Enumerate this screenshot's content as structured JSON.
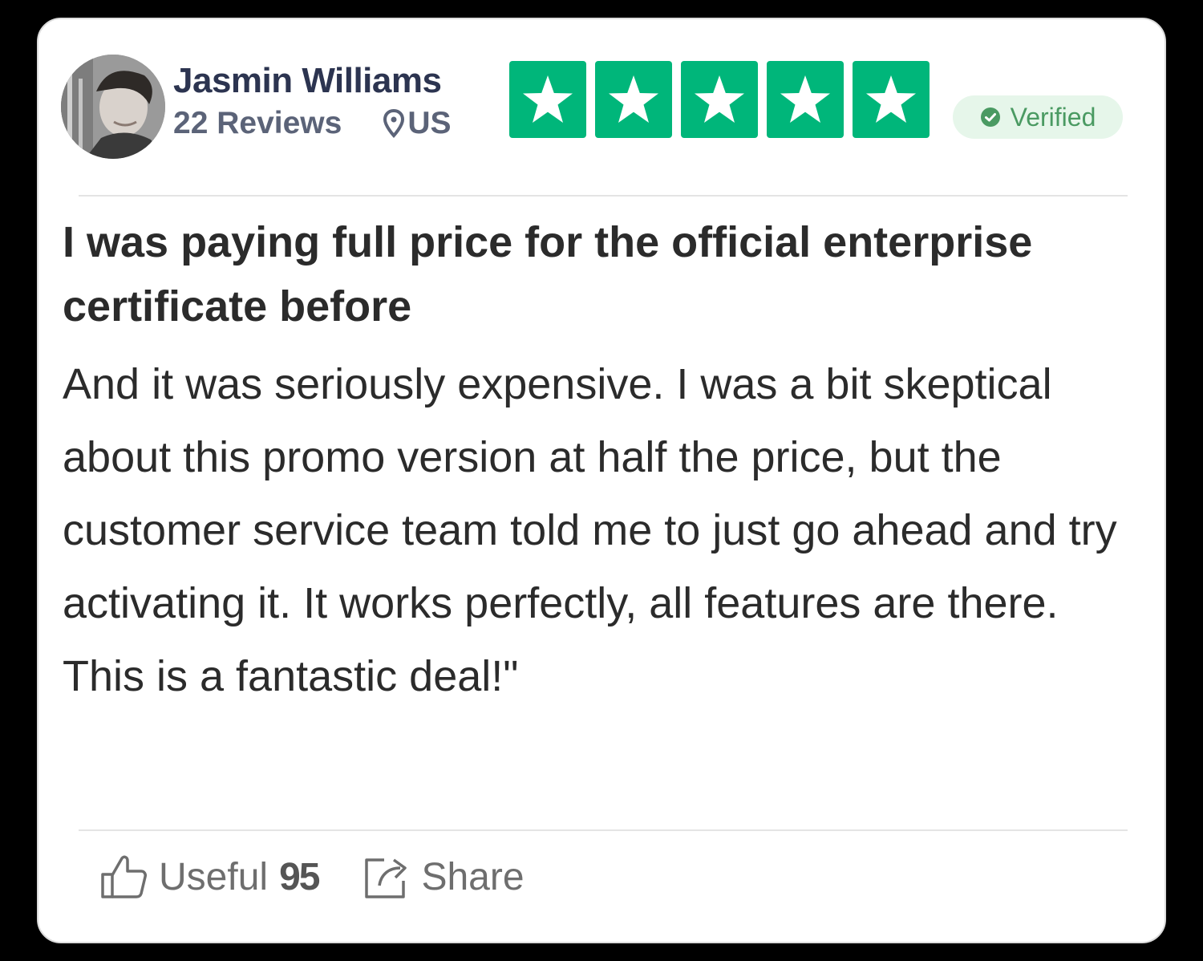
{
  "reviewer": {
    "name": "Jasmin Williams",
    "review_count": "22 Reviews",
    "location": "US",
    "avatar_icon": "avatar-photo"
  },
  "rating": {
    "stars": 5,
    "max": 5,
    "star_color": "#00b67a"
  },
  "badge": {
    "label": "Verified",
    "icon": "check-circle-icon",
    "color": "#4a9a62"
  },
  "review": {
    "title": "I was paying full price for the official enterprise certificate before",
    "body": "And it was seriously expensive. I was a bit skeptical about this promo version at half the price, but the customer service team told me to just go ahead and try activating it. It works perfectly, all features are there. This is a fantastic deal!\""
  },
  "actions": {
    "useful_label": "Useful",
    "useful_count": "95",
    "share_label": "Share"
  }
}
